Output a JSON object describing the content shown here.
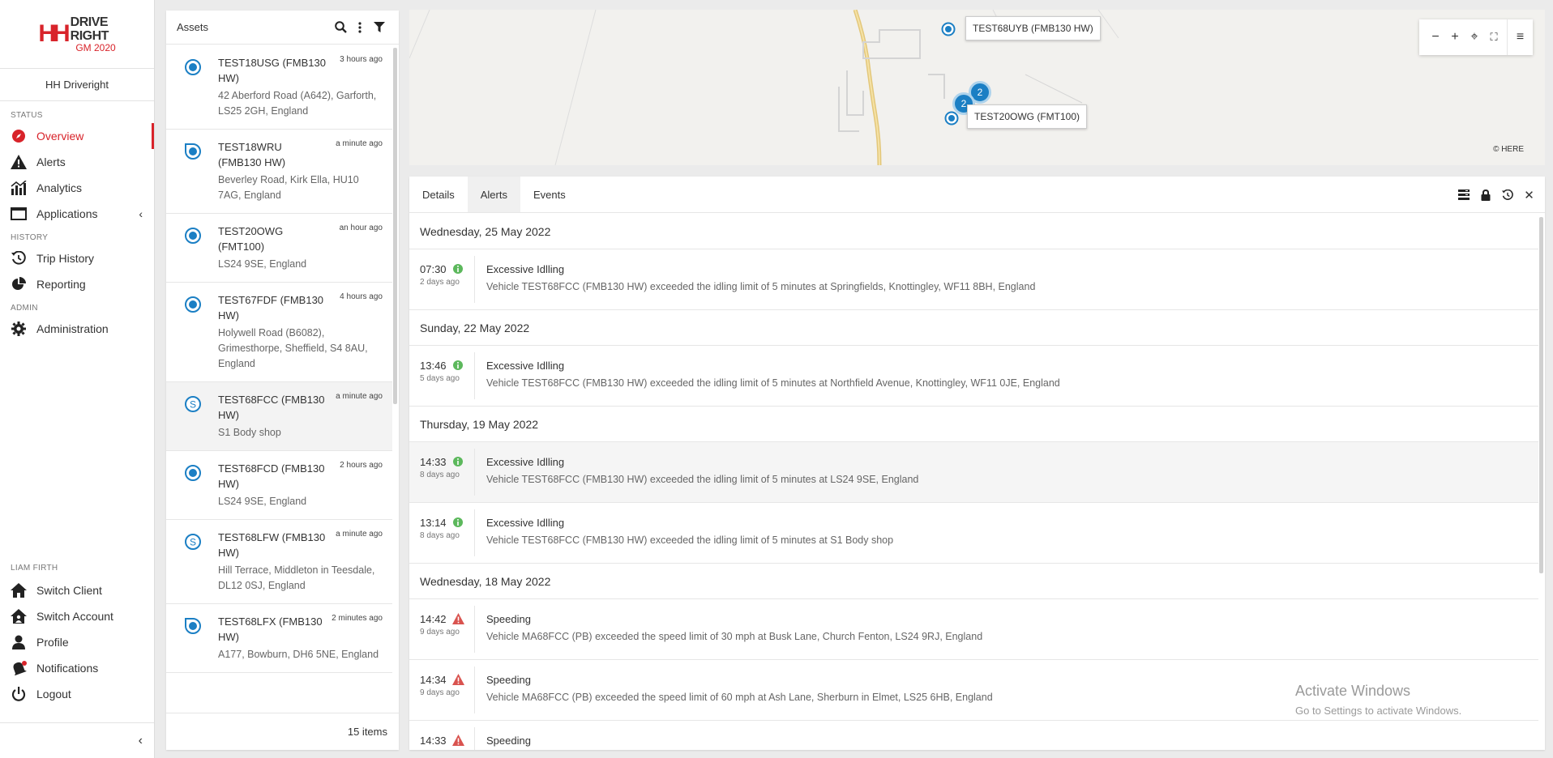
{
  "brand": {
    "mark": "HH",
    "line1": "DRIVE RIGHT",
    "line2": "GM 2020"
  },
  "client_name": "HH Driveright",
  "sidebar": {
    "status_label": "STATUS",
    "history_label": "HISTORY",
    "admin_label": "ADMIN",
    "user_label": "LIAM FIRTH",
    "items": [
      {
        "label": "Overview",
        "icon": "compass-icon"
      },
      {
        "label": "Alerts",
        "icon": "warning-icon"
      },
      {
        "label": "Analytics",
        "icon": "bar-chart-icon"
      },
      {
        "label": "Applications",
        "icon": "window-icon"
      },
      {
        "label": "Trip History",
        "icon": "history-icon"
      },
      {
        "label": "Reporting",
        "icon": "pie-chart-icon"
      },
      {
        "label": "Administration",
        "icon": "gear-icon"
      },
      {
        "label": "Switch Client",
        "icon": "home-icon"
      },
      {
        "label": "Switch Account",
        "icon": "home-user-icon"
      },
      {
        "label": "Profile",
        "icon": "user-icon"
      },
      {
        "label": "Notifications",
        "icon": "bell-icon"
      },
      {
        "label": "Logout",
        "icon": "power-icon"
      }
    ],
    "collapse_glyph": "‹",
    "submenu_glyph": "‹"
  },
  "assets": {
    "title": "Assets",
    "footer": "15 items",
    "items": [
      {
        "name": "TEST18USG (FMB130 HW)",
        "time": "3 hours ago",
        "address": "42 Aberford Road (A642), Garforth, LS25 2GH, England",
        "status": "stopped"
      },
      {
        "name": "TEST18WRU (FMB130 HW)",
        "time": "a minute ago",
        "address": "Beverley Road, Kirk Ella, HU10 7AG, England",
        "status": "moving"
      },
      {
        "name": "TEST20OWG (FMT100)",
        "time": "an hour ago",
        "address": "LS24 9SE, England",
        "status": "stopped"
      },
      {
        "name": "TEST67FDF (FMB130 HW)",
        "time": "4 hours ago",
        "address": "Holywell Road (B6082), Grimesthorpe, Sheffield, S4 8AU, England",
        "status": "stopped"
      },
      {
        "name": "TEST68FCC (FMB130 HW)",
        "time": "a minute ago",
        "address": "S1 Body shop",
        "status": "site"
      },
      {
        "name": "TEST68FCD (FMB130 HW)",
        "time": "2 hours ago",
        "address": "LS24 9SE, England",
        "status": "stopped"
      },
      {
        "name": "TEST68LFW (FMB130 HW)",
        "time": "a minute ago",
        "address": "Hill Terrace, Middleton in Teesdale, DL12 0SJ, England",
        "status": "site"
      },
      {
        "name": "TEST68LFX (FMB130 HW)",
        "time": "2 minutes ago",
        "address": "A177, Bowburn, DH6 5NE, England",
        "status": "moving"
      }
    ]
  },
  "map": {
    "labels": [
      {
        "text": "TEST68UYB (FMB130 HW)"
      },
      {
        "text": "TEST20OWG (FMT100)"
      }
    ],
    "clusters": [
      "2",
      "2"
    ],
    "copyright": "© HERE",
    "controls": {
      "zoom_out": "−",
      "zoom_in": "+",
      "locate": "⌖",
      "fullscreen": "⛶",
      "menu": "≡"
    }
  },
  "details": {
    "tabs": [
      "Details",
      "Alerts",
      "Events"
    ],
    "active_tab": "Alerts",
    "actions": {
      "close": "✕"
    }
  },
  "events": [
    {
      "type": "day",
      "label": "Wednesday, 25 May 2022"
    },
    {
      "type": "event",
      "time": "07:30",
      "ago": "2 days ago",
      "kind": "info",
      "title": "Excessive Idlling",
      "desc": "Vehicle TEST68FCC (FMB130 HW) exceeded the idling limit of 5 minutes at Springfields, Knottingley, WF11 8BH, England"
    },
    {
      "type": "day",
      "label": "Sunday, 22 May 2022"
    },
    {
      "type": "event",
      "time": "13:46",
      "ago": "5 days ago",
      "kind": "info",
      "title": "Excessive Idlling",
      "desc": "Vehicle TEST68FCC (FMB130 HW) exceeded the idling limit of 5 minutes at Northfield Avenue, Knottingley, WF11 0JE, England"
    },
    {
      "type": "day",
      "label": "Thursday, 19 May 2022"
    },
    {
      "type": "event",
      "time": "14:33",
      "ago": "8 days ago",
      "kind": "info",
      "title": "Excessive Idlling",
      "desc": "Vehicle TEST68FCC (FMB130 HW) exceeded the idling limit of 5 minutes at LS24 9SE, England"
    },
    {
      "type": "event",
      "time": "13:14",
      "ago": "8 days ago",
      "kind": "info",
      "title": "Excessive Idlling",
      "desc": "Vehicle TEST68FCC (FMB130 HW) exceeded the idling limit of 5 minutes at S1 Body shop"
    },
    {
      "type": "day",
      "label": "Wednesday, 18 May 2022"
    },
    {
      "type": "event",
      "time": "14:42",
      "ago": "9 days ago",
      "kind": "warning",
      "title": "Speeding",
      "desc": "Vehicle MA68FCC (PB) exceeded the speed limit of 30 mph at Busk Lane, Church Fenton, LS24 9RJ, England"
    },
    {
      "type": "event",
      "time": "14:34",
      "ago": "9 days ago",
      "kind": "warning",
      "title": "Speeding",
      "desc": "Vehicle MA68FCC (PB) exceeded the speed limit of 60 mph at Ash Lane, Sherburn in Elmet, LS25 6HB, England"
    },
    {
      "type": "event",
      "time": "14:33",
      "ago": "",
      "kind": "warning",
      "title": "Speeding",
      "desc": ""
    }
  ],
  "watermark": {
    "line1": "Activate Windows",
    "line2": "Go to Settings to activate Windows."
  },
  "colors": {
    "accent": "#d8232a",
    "status_blue": "#1b7fc4",
    "info_green": "#5cb85c",
    "warning_red": "#d9534f"
  }
}
